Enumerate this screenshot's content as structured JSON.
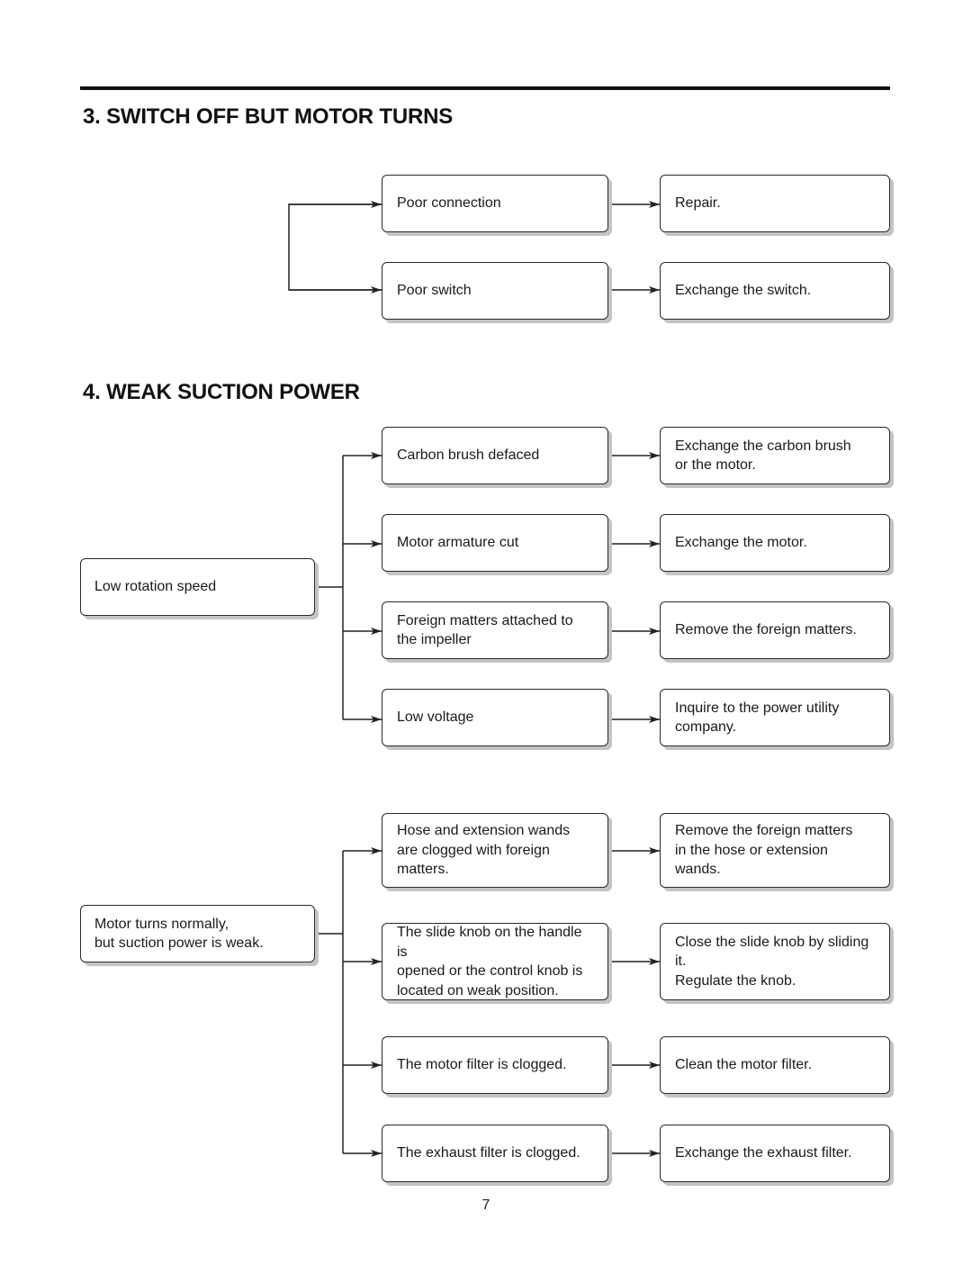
{
  "sections": [
    {
      "title": "3. SWITCH OFF BUT MOTOR TURNS",
      "symptom": null,
      "rows": [
        {
          "cause": "Poor connection",
          "remedy": "Repair."
        },
        {
          "cause": "Poor switch",
          "remedy": "Exchange the switch."
        }
      ]
    },
    {
      "title": "4. WEAK SUCTION POWER",
      "symptom": "Low rotation speed",
      "rows": [
        {
          "cause": "Carbon brush defaced",
          "remedy": "Exchange the carbon brush\nor the motor."
        },
        {
          "cause": "Motor armature cut",
          "remedy": "Exchange the motor."
        },
        {
          "cause": "Foreign matters attached to\nthe impeller",
          "remedy": "Remove the foreign matters."
        },
        {
          "cause": "Low voltage",
          "remedy": "Inquire to the power utility\ncompany."
        }
      ]
    },
    {
      "title": null,
      "symptom": "Motor turns normally,\nbut suction power is weak.",
      "rows": [
        {
          "cause": "Hose and extension wands\nare clogged with foreign\nmatters.",
          "remedy": "Remove the foreign matters\nin the hose or extension\nwands."
        },
        {
          "cause": "The slide knob on the handle is\nopened or the control knob is\nlocated on weak position.",
          "remedy": "Close the slide knob by sliding it.\nRegulate the knob."
        },
        {
          "cause": "The motor filter is clogged.",
          "remedy": "Clean the motor filter."
        },
        {
          "cause": "The exhaust filter is clogged.",
          "remedy": "Exchange the exhaust filter."
        }
      ]
    }
  ],
  "page_number": "7",
  "icons": {
    "arrow": "arrow-right-icon"
  }
}
